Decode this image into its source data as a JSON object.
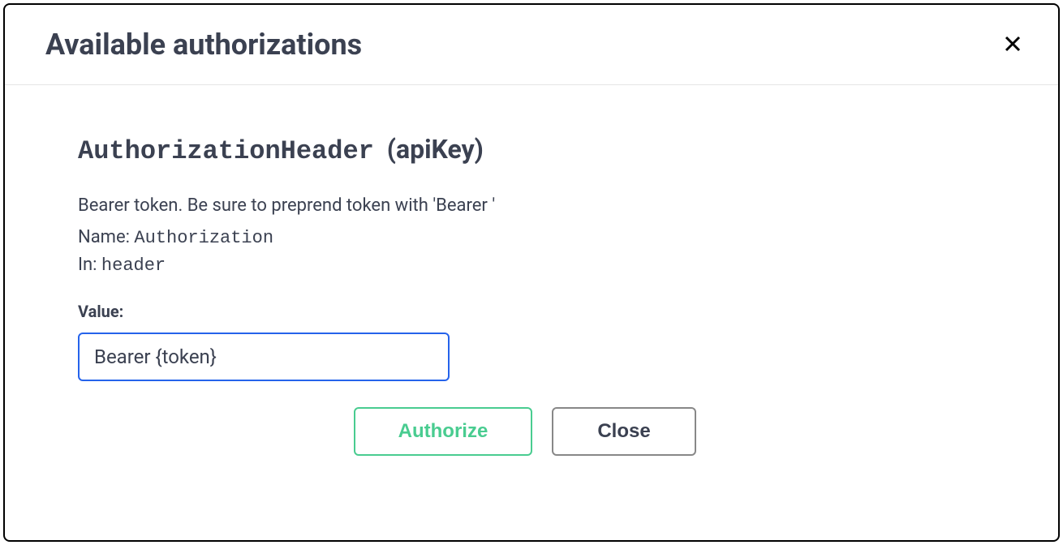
{
  "modal": {
    "title": "Available authorizations"
  },
  "auth": {
    "scheme_name": "AuthorizationHeader",
    "scheme_type": "(apiKey)",
    "description": "Bearer token. Be sure to preprend token with 'Bearer '",
    "name_label": "Name: ",
    "name_value": "Authorization",
    "in_label": "In: ",
    "in_value": "header",
    "value_label": "Value:",
    "value_input": "Bearer {token}"
  },
  "buttons": {
    "authorize": "Authorize",
    "close": "Close"
  }
}
